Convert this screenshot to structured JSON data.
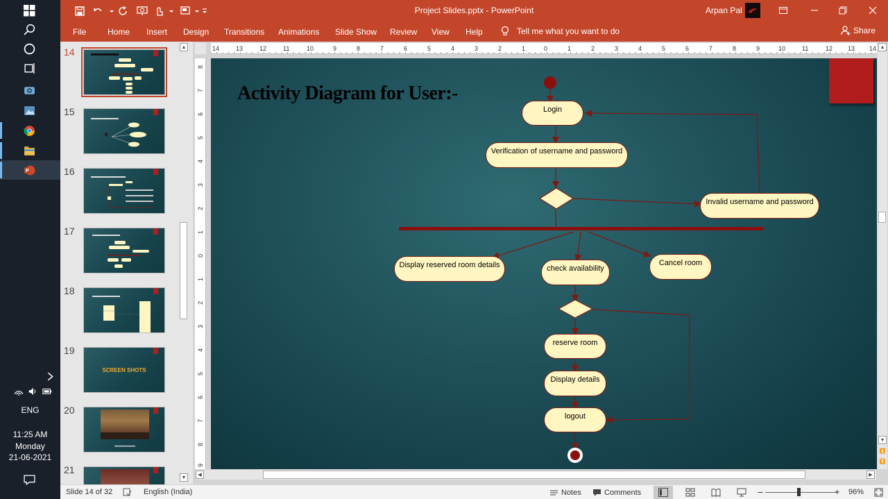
{
  "window": {
    "title": "Project Slides.pptx  -  PowerPoint",
    "user": "Arpan Pal"
  },
  "ribbon": {
    "tabs": [
      "File",
      "Home",
      "Insert",
      "Design",
      "Transitions",
      "Animations",
      "Slide Show",
      "Review",
      "View",
      "Help"
    ],
    "tell_me": "Tell me what you want to do",
    "share": "Share"
  },
  "thumbnails": {
    "numbers": [
      "14",
      "15",
      "16",
      "17",
      "18",
      "19",
      "20",
      "21"
    ],
    "slide19_text": "SCREEN SHOTS"
  },
  "slide": {
    "title": "Activity Diagram for User:-",
    "nodes": {
      "login": "Login",
      "verify": "Verification of username and password",
      "invalid": "Invalid username and password",
      "display_reserved": "Display reserved room details",
      "check": "check availability",
      "cancel": "Cancel room",
      "reserve": "reserve room",
      "display_details": "Display details",
      "logout": "logout"
    }
  },
  "taskbar": {
    "lang": "ENG",
    "time": "11:25 AM",
    "day": "Monday",
    "date": "21-06-2021"
  },
  "status": {
    "slide_info": "Slide 14 of 32",
    "language": "English (India)",
    "notes": "Notes",
    "comments": "Comments",
    "zoom": "96%"
  },
  "colors": {
    "accent": "#c4462a",
    "slide_bg": "#1f5059",
    "node_fill": "#fff6c2",
    "connector": "#7a1b14"
  }
}
